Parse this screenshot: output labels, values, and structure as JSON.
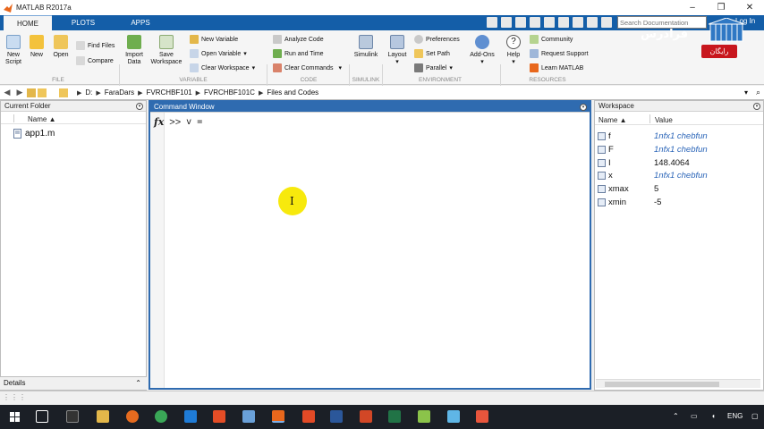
{
  "window": {
    "title": "MATLAB R2017a",
    "controls": [
      "–",
      "❐",
      "✕"
    ]
  },
  "tabs": [
    "HOME",
    "PLOTS",
    "APPS"
  ],
  "search": {
    "placeholder": "Search Documentation"
  },
  "login_label": "Log In",
  "brand": {
    "text": "فرادرس",
    "badge": "رایگان"
  },
  "ribbon": {
    "file": {
      "group": "FILE",
      "new_script": "New\nScript",
      "new": "New",
      "open": "Open",
      "find_files": "Find Files",
      "compare": "Compare"
    },
    "variable": {
      "group": "VARIABLE",
      "import_data": "Import\nData",
      "save_workspace": "Save\nWorkspace",
      "new_variable": "New Variable",
      "open_variable": "Open Variable",
      "clear_workspace": "Clear Workspace"
    },
    "code": {
      "group": "CODE",
      "analyze_code": "Analyze Code",
      "run_and_time": "Run and Time",
      "clear_commands": "Clear Commands"
    },
    "simulink": {
      "group": "SIMULINK",
      "simulink": "Simulink"
    },
    "environment": {
      "group": "ENVIRONMENT",
      "layout": "Layout",
      "preferences": "Preferences",
      "set_path": "Set Path",
      "parallel": "Parallel",
      "addons": "Add-Ons"
    },
    "resources": {
      "group": "RESOURCES",
      "help": "Help",
      "community": "Community",
      "request_support": "Request Support",
      "learn_matlab": "Learn MATLAB"
    }
  },
  "path": [
    "D:",
    "FaraDars",
    "FVRCHBF101",
    "FVRCHBF101C",
    "Files and Codes"
  ],
  "current_folder": {
    "title": "Current Folder",
    "column": "Name ▲",
    "files": [
      "app1.m"
    ],
    "details": "Details"
  },
  "command_window": {
    "title": "Command Window",
    "prompt": ">>",
    "input": "v ="
  },
  "workspace": {
    "title": "Workspace",
    "col_name": "Name ▲",
    "col_value": "Value",
    "rows": [
      {
        "name": "f",
        "value": "1nfx1 chebfun",
        "kind": "fun"
      },
      {
        "name": "F",
        "value": "1nfx1 chebfun",
        "kind": "fun"
      },
      {
        "name": "I",
        "value": "148.4064",
        "kind": "num"
      },
      {
        "name": "x",
        "value": "1nfx1 chebfun",
        "kind": "fun"
      },
      {
        "name": "xmax",
        "value": "5",
        "kind": "num"
      },
      {
        "name": "xmin",
        "value": "-5",
        "kind": "num"
      }
    ]
  },
  "status": "",
  "taskbar": {
    "language": "ENG"
  }
}
